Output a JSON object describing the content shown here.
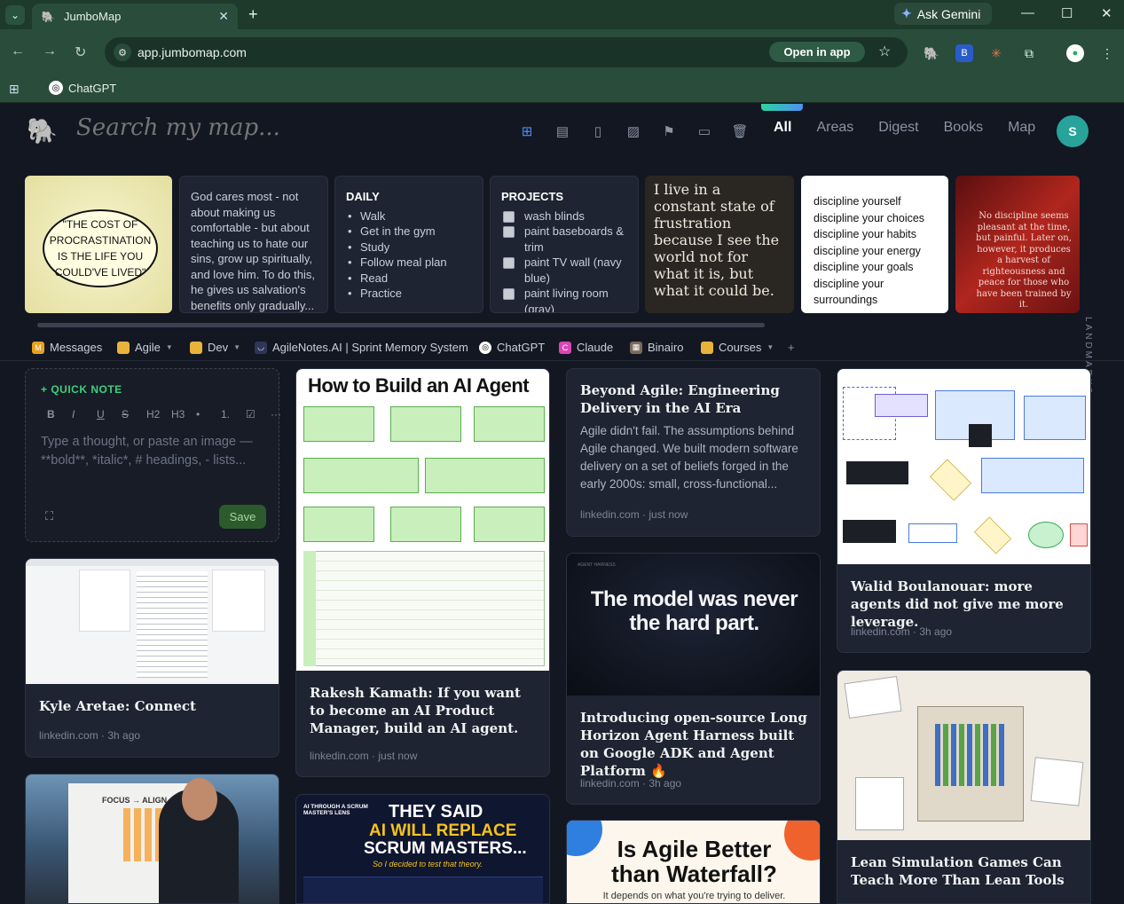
{
  "browser": {
    "tab_title": "JumboMap",
    "new_tab": "+",
    "gemini": "Ask Gemini",
    "url": "app.jumbomap.com",
    "open_in_app": "Open in app",
    "bookmark": "ChatGPT"
  },
  "app": {
    "search_placeholder": "Search my map...",
    "tabs": [
      "All",
      "Areas",
      "Digest",
      "Books",
      "Map"
    ],
    "avatar": "S",
    "landmarks_label": "LANDMARKS",
    "landmarks": {
      "quote1": "\"THE COST OF PROCRASTINATION IS THE LIFE YOU COULD'VE LIVED\"",
      "note1": "God cares most - not about making us comfortable - but about teaching us to hate our sins, grow up spiritually, and love him. To do this, he gives us salvation's benefits only gradually...",
      "daily_title": "DAILY",
      "daily": [
        "Walk",
        "Get in the gym",
        "Study",
        "Follow meal plan",
        "Read",
        "Practice"
      ],
      "projects_title": "PROJECTS",
      "projects": [
        "wash blinds",
        "paint baseboards & trim",
        "paint TV wall (navy blue)",
        "paint living room (gray)"
      ],
      "quote2": "I live in a constant state of frustration because I see the world not for what it is, but what it could be.",
      "discipline": [
        "discipline yourself",
        "discipline your choices",
        "discipline your habits",
        "discipline your energy",
        "discipline your goals",
        "discipline your surroundings"
      ],
      "quote3": "No discipline seems pleasant at the time, but painful. Later on, however, it produces a harvest of righteousness and peace for those who have been trained by it."
    },
    "chips": [
      "Messages",
      "Agile",
      "Dev",
      "AgileNotes.AI | Sprint Memory System",
      "ChatGPT",
      "Claude",
      "Binairo",
      "Courses",
      "+"
    ],
    "quick_note": {
      "label": "QUICK NOTE",
      "format": [
        "B",
        "I",
        "U",
        "S",
        "H2",
        "H3",
        "•",
        "1.",
        "☑",
        "···"
      ],
      "placeholder": "Type a thought, or paste an image — **bold**, *italic*, # headings, - lists...",
      "save": "Save"
    },
    "cards": {
      "kyle": {
        "title": "Kyle Aretae: Connect",
        "meta": "linkedin.com · 3h ago"
      },
      "rakesh": {
        "img_title": "How to Build an AI Agent",
        "title": "Rakesh Kamath: If you want to become an AI Product Manager, build an AI agent.",
        "meta": "linkedin.com · just now"
      },
      "beyond": {
        "title": "Beyond Agile: Engineering Delivery in the AI Era",
        "body": "Agile didn't fail. The assumptions behind Agile changed. We built modern software delivery on a set of beliefs forged in the early 2000s: small, cross-functional...",
        "meta": "linkedin.com · just now"
      },
      "model": {
        "img_text": "The model was never the hard part.",
        "title": "Introducing open-source Long Horizon Agent Harness built on Google ADK and Agent Platform 🔥",
        "meta": "linkedin.com · 3h ago"
      },
      "walid": {
        "title": "Walid Boulanouar: more agents did not give me more leverage.",
        "meta": "linkedin.com · 3h ago"
      },
      "lean": {
        "title": "Lean Simulation Games Can Teach More Than Lean Tools"
      },
      "scrum": {
        "img_text1": "THEY SAID",
        "img_text2": "AI WILL REPLACE",
        "img_text3": "SCRUM MASTERS...",
        "img_text4": "So I decided to test that theory."
      },
      "agile_water": {
        "img_text1": "Is Agile Better",
        "img_text2": "than Waterfall?",
        "img_text3": "It depends on what you're trying to deliver."
      },
      "focus": {
        "img_text": "FOCUS → ALIGN → DELIVER"
      }
    }
  }
}
